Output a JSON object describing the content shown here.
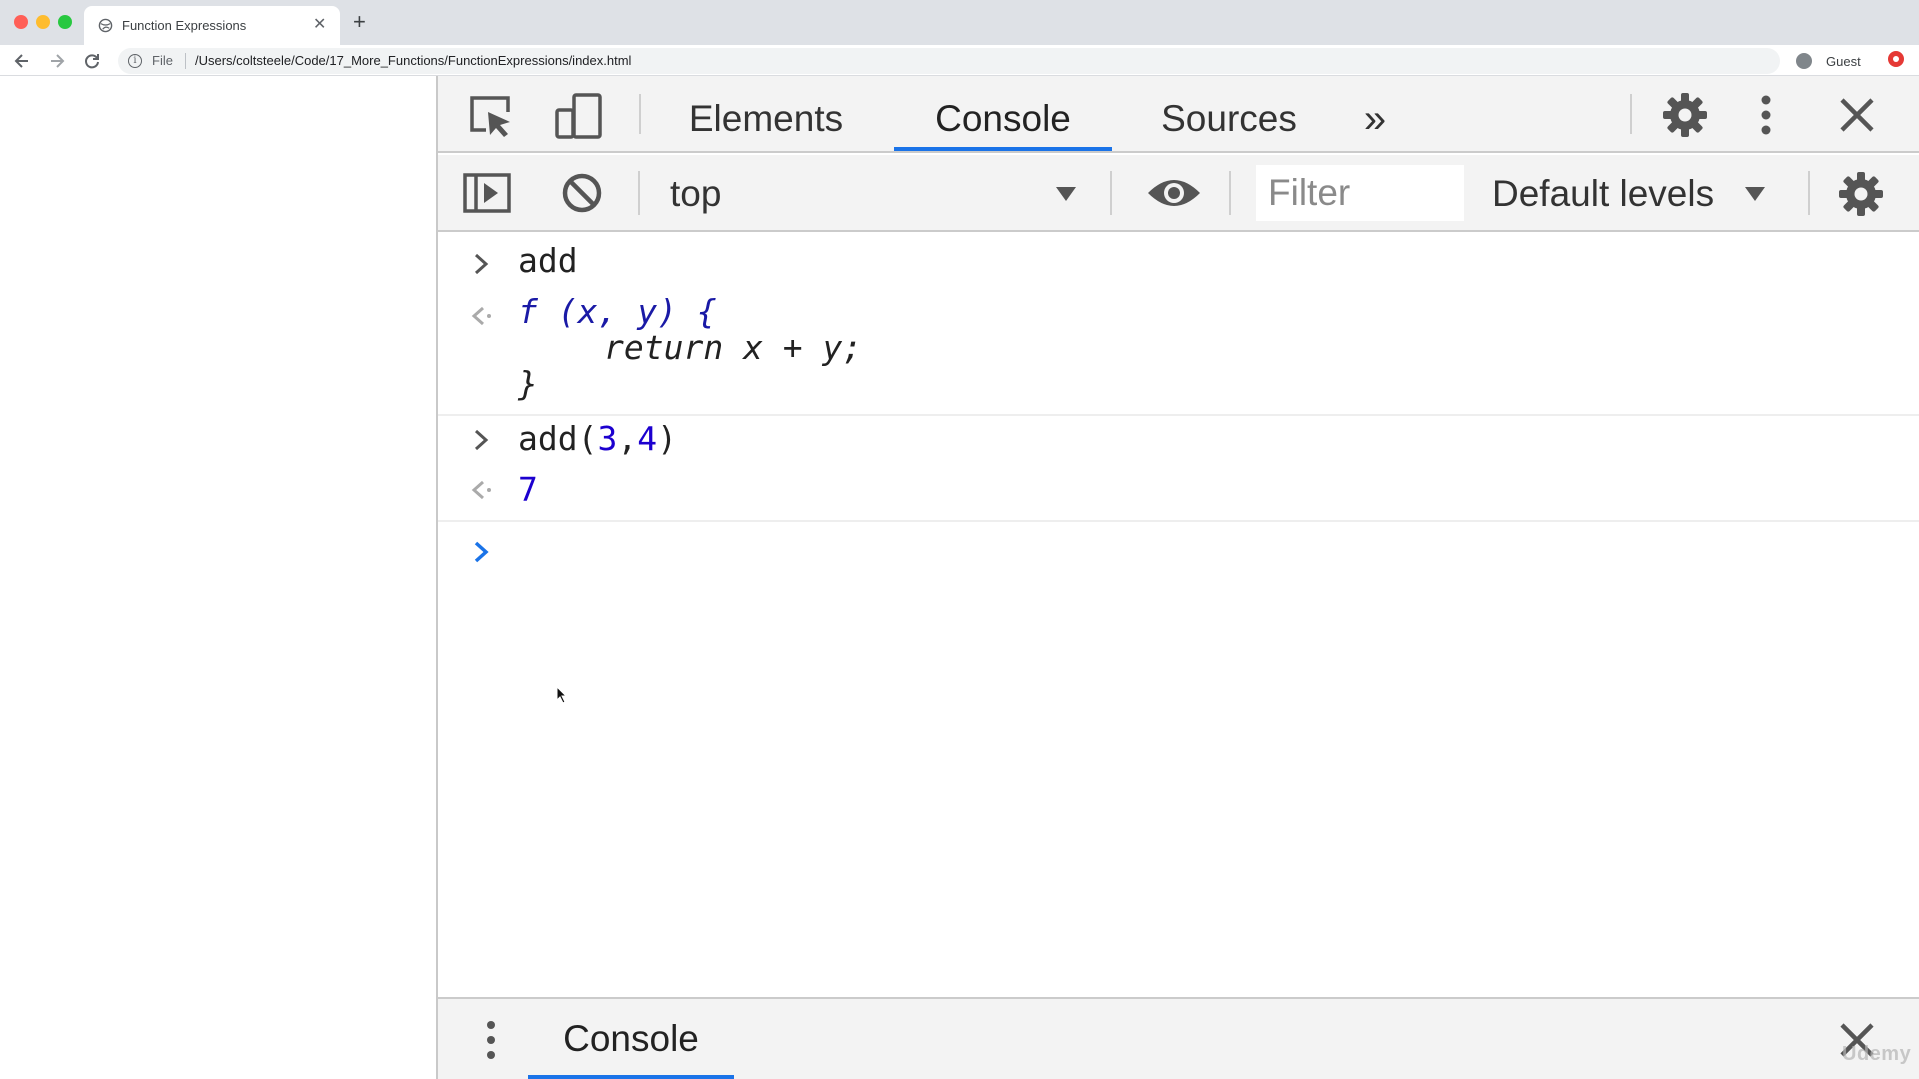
{
  "browser": {
    "tab_title": "Function Expressions",
    "tab_close": "✕",
    "new_tab": "+",
    "url_scheme": "File",
    "url_path": "/Users/coltsteele/Code/17_More_Functions/FunctionExpressions/index.html",
    "profile_label": "Guest"
  },
  "devtools": {
    "tabs": [
      {
        "label": "Elements"
      },
      {
        "label": "Console",
        "active": true
      },
      {
        "label": "Sources"
      }
    ],
    "more_tabs": "»",
    "console_toolbar": {
      "context": "top",
      "filter_placeholder": "Filter",
      "levels": "Default levels"
    },
    "console_entries": [
      {
        "kind": "input",
        "text": "add"
      },
      {
        "kind": "result",
        "lines": [
          "f (x, y) {",
          "return x + y;",
          "}"
        ]
      },
      {
        "kind": "input",
        "text_prefix": "add(",
        "args": [
          "3",
          "4"
        ],
        "text_suffix": ")"
      },
      {
        "kind": "result",
        "text": "7"
      },
      {
        "kind": "prompt",
        "text": ""
      }
    ],
    "drawer": {
      "tab_label": "Console"
    }
  },
  "watermark": "Udemy",
  "colors": {
    "accent": "#1a73e8",
    "function_keyword": "#1a1aa6",
    "number": "#1c00cf",
    "active_prompt": "#1a73e8",
    "toolbar_bg": "#f3f3f3"
  }
}
